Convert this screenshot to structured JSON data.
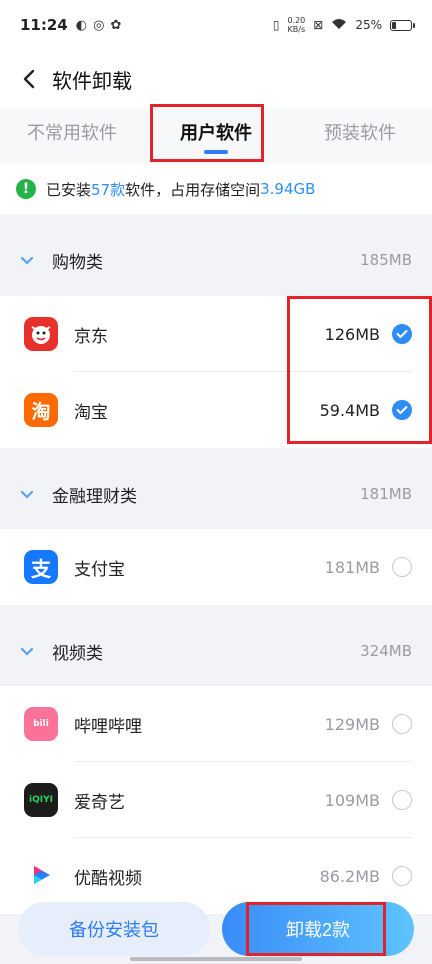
{
  "status": {
    "time": "11:24",
    "net_top": "0.20",
    "net_bottom": "KB/s",
    "battery": "25%",
    "battery_level": 0.25
  },
  "header": {
    "title": "软件卸载"
  },
  "tabs": [
    {
      "label": "不常用软件",
      "active": false
    },
    {
      "label": "用户软件",
      "active": true
    },
    {
      "label": "预装软件",
      "active": false
    }
  ],
  "summary": {
    "prefix": "已安装",
    "count": "57款",
    "mid": "软件，占用存储空间",
    "size": "3.94GB"
  },
  "groups": [
    {
      "name": "购物类",
      "size": "185MB",
      "apps": [
        {
          "name": "京东",
          "size": "126MB",
          "selected": true,
          "icon": "jd-icon",
          "color": "#e8312d"
        },
        {
          "name": "淘宝",
          "size": "59.4MB",
          "selected": true,
          "icon": "taobao-icon",
          "color": "#ff6a00"
        }
      ]
    },
    {
      "name": "金融理财类",
      "size": "181MB",
      "apps": [
        {
          "name": "支付宝",
          "size": "181MB",
          "selected": false,
          "icon": "alipay-icon",
          "color": "#1677ff"
        }
      ]
    },
    {
      "name": "视频类",
      "size": "324MB",
      "apps": [
        {
          "name": "哔哩哔哩",
          "size": "129MB",
          "selected": false,
          "icon": "bilibili-icon",
          "color": "#fb7299"
        },
        {
          "name": "爱奇艺",
          "size": "109MB",
          "selected": false,
          "icon": "iqiyi-icon",
          "color": "#1ebc4b"
        },
        {
          "name": "优酷视频",
          "size": "86.2MB",
          "selected": false,
          "icon": "youku-icon",
          "color": "#ffffff"
        }
      ]
    }
  ],
  "buttons": {
    "backup": "备份安装包",
    "uninstall": "卸载2款"
  }
}
